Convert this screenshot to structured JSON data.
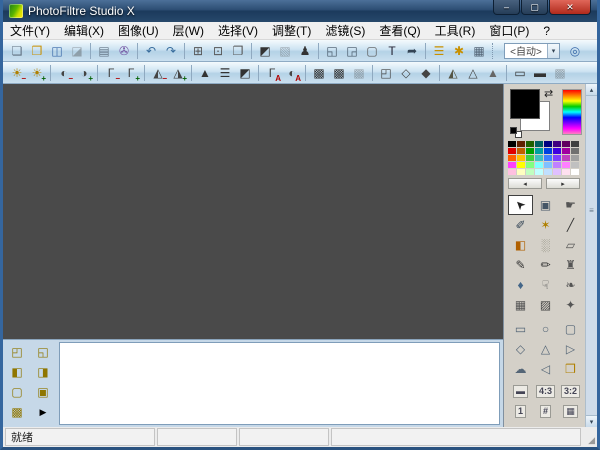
{
  "window": {
    "title": "PhotoFiltre Studio X",
    "controls": [
      {
        "name": "minimize-button",
        "glyph": "–"
      },
      {
        "name": "maximize-button",
        "glyph": "▢"
      },
      {
        "name": "close-button",
        "glyph": "✕"
      }
    ]
  },
  "menu": {
    "items": [
      {
        "name": "menu-item-file",
        "label": "文件(Y)"
      },
      {
        "name": "menu-item-edit",
        "label": "编辑(X)"
      },
      {
        "name": "menu-item-image",
        "label": "图像(U)"
      },
      {
        "name": "menu-item-layer",
        "label": "层(W)"
      },
      {
        "name": "menu-item-selection",
        "label": "选择(V)"
      },
      {
        "name": "menu-item-adjust",
        "label": "调整(T)"
      },
      {
        "name": "menu-item-filter",
        "label": "滤镜(S)"
      },
      {
        "name": "menu-item-view",
        "label": "查看(Q)"
      },
      {
        "name": "menu-item-tools",
        "label": "工具(R)"
      },
      {
        "name": "menu-item-window",
        "label": "窗口(P)"
      },
      {
        "name": "menu-item-help",
        "label": "?"
      }
    ]
  },
  "toolbar_main": {
    "zoom_value": "<自动>",
    "zoom_dropdown_glyph": "▾",
    "items": [
      {
        "name": "new-file-button",
        "glyph": "❏",
        "color": "#607080"
      },
      {
        "name": "open-file-button",
        "glyph": "❒",
        "color": "#c89000"
      },
      {
        "name": "save-button",
        "glyph": "◫",
        "color": "#3868a8"
      },
      {
        "name": "save-as-button",
        "glyph": "◪",
        "disabled": true
      },
      {
        "sep": true
      },
      {
        "name": "print-button",
        "glyph": "▤",
        "color": "#667788"
      },
      {
        "name": "scan-button",
        "glyph": "✇",
        "color": "#7050a0"
      },
      {
        "sep": true
      },
      {
        "name": "undo-button",
        "glyph": "↶",
        "color": "#356a9a"
      },
      {
        "name": "redo-button",
        "glyph": "↷",
        "color": "#356a9a"
      },
      {
        "sep": true
      },
      {
        "name": "image-size-button",
        "glyph": "⊞",
        "color": "#555555"
      },
      {
        "name": "canvas-size-button",
        "glyph": "⊡",
        "color": "#555555"
      },
      {
        "name": "duplicate-image-button",
        "glyph": "❐",
        "color": "#555555"
      },
      {
        "sep": true
      },
      {
        "name": "histogram-button",
        "glyph": "◩",
        "color": "#333333"
      },
      {
        "name": "automate-button",
        "glyph": "▧",
        "disabled": true
      },
      {
        "name": "photomask-button",
        "glyph": "♟",
        "color": "#333333"
      },
      {
        "sep": true
      },
      {
        "name": "new-layer-button",
        "glyph": "◱",
        "color": "#445566"
      },
      {
        "name": "merge-layers-button",
        "glyph": "◲",
        "color": "#445566"
      },
      {
        "name": "show-selection-button",
        "glyph": "▢",
        "color": "#555555"
      },
      {
        "name": "text-button",
        "glyph": "T",
        "color": "#222233"
      },
      {
        "name": "vector-path-button",
        "glyph": "➦",
        "color": "#334455"
      },
      {
        "sep": true
      },
      {
        "name": "image-explorer-button",
        "glyph": "☰",
        "accent": true
      },
      {
        "name": "plugins-button",
        "glyph": "✱",
        "accent": true
      },
      {
        "name": "tool-options-button",
        "glyph": "▦",
        "color": "#556677"
      },
      {
        "sep": true,
        "dotted": true
      }
    ]
  },
  "toolbar_adjust": {
    "items": [
      {
        "name": "brightness-minus-button",
        "glyph": "☀",
        "sub": "−",
        "color": "#b08000"
      },
      {
        "name": "brightness-plus-button",
        "glyph": "☀",
        "sub": "+",
        "color": "#b08000"
      },
      {
        "sep": true
      },
      {
        "name": "contrast-minus-button",
        "glyph": "◐",
        "sub": "−",
        "color": "#444444"
      },
      {
        "name": "contrast-plus-button",
        "glyph": "◑",
        "sub": "+",
        "color": "#444444"
      },
      {
        "sep": true
      },
      {
        "name": "gamma-minus-button",
        "glyph": "Γ",
        "sub": "−",
        "color": "#444444"
      },
      {
        "name": "gamma-plus-button",
        "glyph": "Γ",
        "sub": "+",
        "color": "#444444"
      },
      {
        "sep": true
      },
      {
        "name": "saturation-minus-button",
        "glyph": "◭",
        "sub": "−",
        "color": "#444444"
      },
      {
        "name": "saturation-plus-button",
        "glyph": "◮",
        "sub": "+",
        "color": "#444444"
      },
      {
        "sep": true
      },
      {
        "name": "histogram-adjust-button",
        "glyph": "▲",
        "color": "#333333"
      },
      {
        "name": "levels-button",
        "glyph": "☰",
        "color": "#333333"
      },
      {
        "name": "invert-button",
        "glyph": "◩",
        "color": "#333333"
      },
      {
        "sep": true
      },
      {
        "name": "auto-levels-button",
        "glyph": "Γ",
        "sub": "A",
        "color": "#444444"
      },
      {
        "name": "auto-contrast-button",
        "glyph": "◐",
        "sub": "A",
        "color": "#444444"
      },
      {
        "sep": true
      },
      {
        "name": "reduce-size-button",
        "glyph": "▩",
        "color": "#333333"
      },
      {
        "name": "resize-button",
        "glyph": "▩",
        "color": "#333333"
      },
      {
        "name": "adapt-size-button",
        "glyph": "▩",
        "disabled": true
      },
      {
        "sep": true
      },
      {
        "name": "transform-button",
        "glyph": "◰",
        "color": "#444444"
      },
      {
        "name": "soften-button",
        "glyph": "◇",
        "color": "#444444"
      },
      {
        "name": "sharpen-drop-button",
        "glyph": "◆",
        "color": "#444444"
      },
      {
        "sep": true
      },
      {
        "name": "relief-button",
        "glyph": "◭",
        "color": "#555544"
      },
      {
        "name": "sharpen-more-button",
        "glyph": "△",
        "color": "#444444"
      },
      {
        "name": "blur-more-button",
        "glyph": "▲",
        "color": "#666666"
      },
      {
        "sep": true
      },
      {
        "name": "screen-size-button",
        "glyph": "▭",
        "color": "#333333"
      },
      {
        "name": "fullscreen-button",
        "glyph": "▬",
        "color": "#333333"
      },
      {
        "name": "frame-button",
        "glyph": "▩",
        "disabled": true
      }
    ]
  },
  "right_panel": {
    "colors": {
      "foreground": "#000000",
      "background": "#ffffff",
      "swap_glyph": "⇄"
    },
    "rainbow": [
      "#ff0000",
      "#ff8000",
      "#ffff00",
      "#00cc00",
      "#00ffff",
      "#0000ff",
      "#8000ff",
      "#ff00ff",
      "#ff80c0"
    ],
    "palette_rows": [
      [
        "#000000",
        "#602000",
        "#206000",
        "#006060",
        "#000080",
        "#400080",
        "#600060",
        "#404040"
      ],
      [
        "#e00000",
        "#c06000",
        "#00a000",
        "#00a0a0",
        "#0040e0",
        "#4000e0",
        "#a000a0",
        "#707070"
      ],
      [
        "#ff6000",
        "#ffc000",
        "#40d040",
        "#40c0c0",
        "#4080ff",
        "#8040ff",
        "#c040c0",
        "#a0a0a0"
      ],
      [
        "#ff40ff",
        "#ffff00",
        "#80ff80",
        "#80ffff",
        "#80c0ff",
        "#c080ff",
        "#ff80ff",
        "#c0c0c0"
      ],
      [
        "#ffc0e0",
        "#ffffc0",
        "#c0ffc0",
        "#c0ffff",
        "#c0e0ff",
        "#e0c0ff",
        "#ffe0f0",
        "#ffffff"
      ]
    ],
    "palette_nav": {
      "prev_glyph": "◂",
      "next_glyph": "▸"
    },
    "scrollbar": {
      "up_glyph": "▴",
      "down_glyph": "▾",
      "grip_glyph": "≡"
    },
    "tools": [
      {
        "name": "selection-tool",
        "glyph": "➤",
        "selected": true,
        "rot": -135,
        "color": "#222222"
      },
      {
        "name": "layer-manager-tool",
        "glyph": "▣",
        "color": "#445566"
      },
      {
        "name": "hand-tool",
        "glyph": "☛",
        "color": "#555555"
      },
      {
        "name": "color-picker-tool",
        "glyph": "✐",
        "color": "#334455"
      },
      {
        "name": "magic-wand-tool",
        "glyph": "✶",
        "color": "#b08000"
      },
      {
        "name": "line-tool",
        "glyph": "╱",
        "color": "#333333"
      },
      {
        "name": "fill-tool",
        "glyph": "◧",
        "color": "#b06000"
      },
      {
        "name": "spray-tool",
        "glyph": "░",
        "color": "#777766"
      },
      {
        "name": "eraser-tool",
        "glyph": "▱",
        "color": "#555555"
      },
      {
        "name": "brush-tool",
        "glyph": "✎",
        "color": "#333333"
      },
      {
        "name": "advanced-brush-tool",
        "glyph": "✏",
        "color": "#333333"
      },
      {
        "name": "clone-stamp-tool",
        "glyph": "♜",
        "color": "#555555"
      },
      {
        "name": "blur-tool",
        "glyph": "♦",
        "color": "#446688"
      },
      {
        "name": "smudge-tool",
        "glyph": "☟",
        "color": "#555555"
      },
      {
        "name": "artistic-brush-tool",
        "glyph": "❧",
        "color": "#555555"
      },
      {
        "name": "nozzle-tool",
        "glyph": "▦",
        "color": "#555555"
      },
      {
        "name": "photomask-tool",
        "glyph": "▨",
        "color": "#444444"
      },
      {
        "name": "shield-tool",
        "glyph": "✦",
        "color": "#555555"
      }
    ],
    "shapes": [
      {
        "name": "shape-rectangle",
        "glyph": "▭",
        "color": "#556677"
      },
      {
        "name": "shape-ellipse",
        "glyph": "○",
        "color": "#556677"
      },
      {
        "name": "shape-rounded-rect",
        "glyph": "▢",
        "color": "#556677"
      },
      {
        "name": "shape-diamond",
        "glyph": "◇",
        "color": "#556677"
      },
      {
        "name": "shape-triangle",
        "glyph": "△",
        "color": "#556677"
      },
      {
        "name": "shape-right-triangle",
        "glyph": "▷",
        "color": "#556677"
      },
      {
        "name": "shape-freehand-lasso",
        "glyph": "☁",
        "color": "#556677"
      },
      {
        "name": "shape-polygon-lasso",
        "glyph": "◁",
        "color": "#556677"
      },
      {
        "name": "load-shape-button",
        "glyph": "❒",
        "color": "#b08000"
      }
    ],
    "options": [
      {
        "name": "ratio-manual-button",
        "glyph": "▬"
      },
      {
        "name": "ratio-4-3-button",
        "glyph": "4:3"
      },
      {
        "name": "ratio-3-2-button",
        "glyph": "3:2"
      },
      {
        "name": "ratio-1-1-button",
        "glyph": "1"
      },
      {
        "name": "crop-marks-button",
        "glyph": "#"
      },
      {
        "name": "keyboard-input-button",
        "glyph": "▦"
      }
    ]
  },
  "layers_toolbar": {
    "items": [
      {
        "name": "layers-panel-new-button",
        "glyph": "◰"
      },
      {
        "name": "layers-panel-duplicate-button",
        "glyph": "◱"
      },
      {
        "name": "layers-panel-color-button",
        "glyph": "◧"
      },
      {
        "name": "layers-panel-save-button",
        "glyph": "◨"
      },
      {
        "name": "layers-panel-selection-button",
        "glyph": "▢"
      },
      {
        "name": "layers-panel-image-button",
        "glyph": "▣"
      },
      {
        "name": "layers-panel-options-button",
        "glyph": "▩"
      },
      {
        "name": "layers-panel-expand-button",
        "glyph": "▶",
        "dark": true
      }
    ]
  },
  "status_bar": {
    "message": "就绪"
  },
  "theme": {
    "workspace_color": "#4a4a4a",
    "chrome_blue": "#35669e",
    "toolbar_tint": "#cde3f2"
  }
}
